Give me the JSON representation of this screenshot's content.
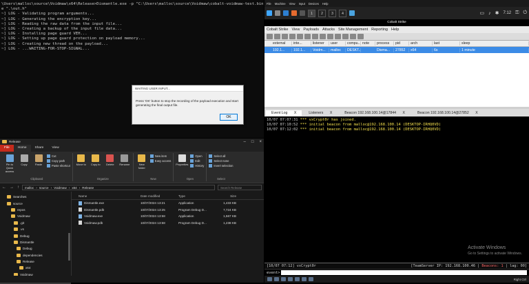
{
  "terminal": {
    "lines": [
      "\\Users\\malloc\\source\\Voidmaw\\x64\\Release>Dismantle.exe -p \"C:\\Users\\malloc\\source\\Voidmaw\\cobalt-voidmaw-test.bin\"",
      "e \".\\out.h\"",
      "~] LOG - Validating program arguments...",
      "~] LOG - Generating the encryption key...",
      "~] LOG - Reading the raw data from the input file...",
      "~] LOG - Creating a backup of the input file data...",
      "~] LOG - Installing page guard VEH...",
      "~] LOG - Setting up page guard protection on payload memory...",
      "~] LOG - Creating new thread on the payload...",
      "~] LOG - ...WAITING-FOR-STOP-SIGNAL..."
    ]
  },
  "dialog": {
    "title": "WAITING USER INPUT...",
    "message": "Press 'OK' button to stop the recording of the payload execution and start generating the final output file.",
    "ok_label": "OK"
  },
  "explorer": {
    "title": "Release",
    "tabs": [
      "File",
      "Home",
      "Share",
      "View"
    ],
    "ribbon": {
      "clipboard": {
        "pin": "Pin to Quick access",
        "copy": "Copy",
        "paste": "Paste",
        "cut": "Cut",
        "copy_path": "Copy path",
        "paste_shortcut": "Paste shortcut",
        "group": "Clipboard"
      },
      "organize": {
        "move": "Move to",
        "copy": "Copy to",
        "delete": "Delete",
        "rename": "Rename",
        "group": "Organize"
      },
      "new": {
        "folder": "New folder",
        "item": "New item",
        "easy": "Easy access",
        "group": "New"
      },
      "open": {
        "properties": "Properties",
        "open": "Open",
        "edit": "Edit",
        "history": "History",
        "group": "Open"
      },
      "select": {
        "all": "Select all",
        "none": "Select none",
        "invert": "Invert selection",
        "group": "Select"
      }
    },
    "path": [
      "malloc",
      "source",
      "Voidmaw",
      "x64",
      "Release"
    ],
    "search_placeholder": "Search Release",
    "nav": [
      "Searches",
      "source",
      "repos",
      "Voidmaw",
      ".git",
      ".vs",
      "Debug",
      "Dismantle",
      "Debug",
      "dependencies",
      "Release",
      "x64",
      "Voidmaw",
      "x64"
    ],
    "columns": [
      "Name",
      "Date modified",
      "Type",
      "Size"
    ],
    "files": [
      {
        "name": "Dismantle.exe",
        "date": "10/07/2024 13:21",
        "type": "Application",
        "size": "1,433 KB"
      },
      {
        "name": "Dismantle.pdb",
        "date": "10/07/2024 13:25",
        "type": "Program Debug D...",
        "size": "7,724 KB"
      },
      {
        "name": "Voidmaw.exe",
        "date": "10/07/2024 13:58",
        "type": "Application",
        "size": "1,567 KB"
      },
      {
        "name": "Voidmaw.pdb",
        "date": "10/07/2024 13:58",
        "type": "Program Debug D...",
        "size": "1,238 KB"
      }
    ],
    "status": "4 items"
  },
  "topbar": {
    "menu": [
      "File",
      "Machine",
      "View",
      "Input",
      "Devices",
      "Help"
    ]
  },
  "panel": {
    "workspaces": [
      "1",
      "2",
      "3",
      "4"
    ],
    "time": "7:12"
  },
  "cobalt": {
    "title": "Cobalt Strike",
    "menu": [
      "Cobalt Strike",
      "View",
      "Payloads",
      "Attacks",
      "Site Management",
      "Reporting",
      "Help"
    ],
    "columns": [
      "",
      "external",
      "inte...",
      "listener",
      "user",
      "compu...",
      "note",
      "process",
      "pid",
      "arch",
      "last",
      "sleep"
    ],
    "row": [
      "",
      "192.1...",
      "192.1...",
      "Voidm...",
      "malloc",
      "DESKT...",
      "",
      "Disma...",
      "27852",
      "x64",
      "6s",
      "1 minute"
    ],
    "tabs": [
      "Event Log",
      "Listeners",
      "Beacon 192.168.100.14@17844",
      "Beacon 192.168.100.14@27852"
    ],
    "log": [
      {
        "time": "10/07 07:07:31",
        "text": " *** vxCrypt0r has joined."
      },
      {
        "time": "10/07 07:10:52",
        "text": " *** initial beacon from malloc@192.168.100.14 (DESKTOP-IRHQ0VD)"
      },
      {
        "time": "10/07 07:12:02",
        "text": " *** initial beacon from malloc@192.168.100.14 (DESKTOP-IRHQ0VD)"
      }
    ],
    "watermark": {
      "line1": "Activate Windows",
      "line2": "Go to Settings to activate Windows."
    },
    "status_left": "[10/07 07:12] vxCrypt0r",
    "status_server": "[TeamServer IP: 192.168.100.46 |",
    "status_beacons": "Beacons: 1",
    "status_lag": "| lag: 00]",
    "prompt": "event>"
  },
  "vmtaskbar": {
    "right": "Right Ctrl"
  }
}
